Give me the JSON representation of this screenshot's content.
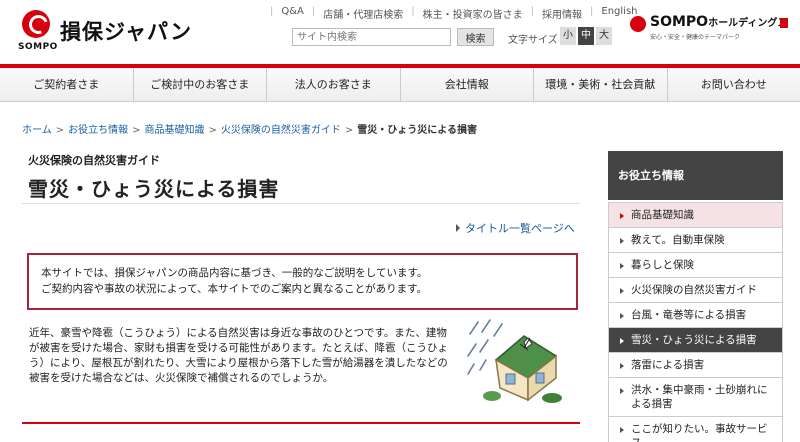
{
  "brand": {
    "name": "損保ジャパン",
    "logo_sub": "SOMPO",
    "holdings_name": "SOMPO",
    "holdings_suffix": "ホールディングス",
    "holdings_tagline": "安心・安全・健康のテーマパーク",
    "brand_red": "#d7000f"
  },
  "utility_nav": [
    "Q&A",
    "店舗・代理店検索",
    "株主・投資家の皆さま",
    "採用情報",
    "English"
  ],
  "search": {
    "placeholder": "サイト内検索",
    "button": "検索"
  },
  "text_size": {
    "label": "文字サイズ",
    "small": "小",
    "medium": "中",
    "large": "大",
    "selected": "中"
  },
  "main_nav": [
    "ご契約者さま",
    "ご検討中のお客さま",
    "法人のお客さま",
    "会社情報",
    "環境・美術・社会貢献",
    "お問い合わせ"
  ],
  "breadcrumb": {
    "items": [
      "ホーム",
      "お役立ち情報",
      "商品基礎知識",
      "火災保険の自然災害ガイド"
    ],
    "current": "雪災・ひょう災による損害"
  },
  "page": {
    "kicker": "火災保険の自然災害ガイド",
    "title": "雪災・ひょう災による損害",
    "title_list_link": "タイトル一覧ページへ",
    "notice_line1": "本サイトでは、損保ジャパンの商品内容に基づき、一般的なご説明をしています。",
    "notice_line2": "ご契約内容や事故の状況によって、本サイトでのご案内と異なることがあります。",
    "intro": "近年、豪雪や降雹（こうひょう）による自然災害は身近な事故のひとつです。また、建物が被害を受けた場合、家財も損害を受ける可能性があります。たとえば、降雹（こうひょう）により、屋根瓦が割れたり、大雪により屋根から落下した雪が給湯器を潰したなどの被害を受けた場合などは、火災保険で補償されるのでしょうか。",
    "illustration": "house-with-hail-icon"
  },
  "sidebar": {
    "heading": "お役立ち情報",
    "items": [
      {
        "label": "商品基礎知識",
        "state": "selected"
      },
      {
        "label": "教えて。自動車保険",
        "state": "normal"
      },
      {
        "label": "暮らしと保険",
        "state": "normal"
      },
      {
        "label": "火災保険の自然災害ガイド",
        "state": "normal"
      },
      {
        "label": "台風・竜巻等による損害",
        "state": "normal"
      },
      {
        "label": "雪災・ひょう災による損害",
        "state": "active"
      },
      {
        "label": "落雷による損害",
        "state": "normal"
      },
      {
        "label": "洪水・集中豪雨・土砂崩れによる損害",
        "state": "normal"
      },
      {
        "label": "ここが知りたい。事故サービス",
        "state": "normal"
      }
    ]
  }
}
